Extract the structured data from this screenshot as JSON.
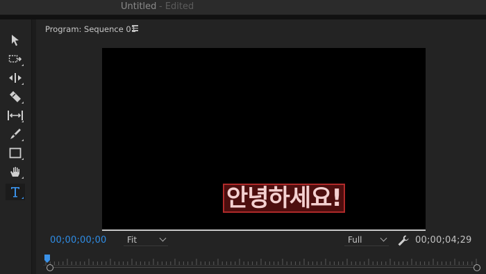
{
  "window": {
    "title": "Untitled",
    "status": "- Edited"
  },
  "toolbar": {
    "tools": [
      {
        "name": "selection-tool",
        "icon": "arrow-icon"
      },
      {
        "name": "track-select-tool",
        "icon": "track-select-icon"
      },
      {
        "name": "ripple-edit-tool",
        "icon": "ripple-edit-icon"
      },
      {
        "name": "razor-tool",
        "icon": "razor-icon"
      },
      {
        "name": "slip-tool",
        "icon": "slip-icon"
      },
      {
        "name": "pen-tool",
        "icon": "pen-icon"
      },
      {
        "name": "rectangle-tool",
        "icon": "rectangle-icon"
      },
      {
        "name": "hand-tool",
        "icon": "hand-icon"
      },
      {
        "name": "type-tool",
        "icon": "type-icon",
        "active": true
      }
    ]
  },
  "monitor": {
    "title": "Program: Sequence 01",
    "subtitle_text": "안녕하세요!",
    "current_timecode": "00;00;00;00",
    "duration_timecode": "00;00;04;29",
    "zoom": "Fit",
    "resolution": "Full"
  },
  "colors": {
    "accent": "#2f8de6",
    "subtitle_text": "#f4d0d0",
    "subtitle_box": "#b02a2a",
    "panel_bg": "#232323"
  }
}
